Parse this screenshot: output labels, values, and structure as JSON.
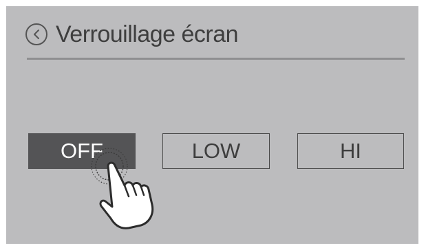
{
  "header": {
    "back_icon": "chevron-left-circle-icon",
    "title": "Verrouillage écran"
  },
  "options": [
    {
      "label": "OFF",
      "selected": true
    },
    {
      "label": "LOW",
      "selected": false
    },
    {
      "label": "HI",
      "selected": false
    }
  ],
  "touch_indicator": "tap-hand-icon",
  "colors": {
    "screen_background": "#bcbcbe",
    "selected_background": "#545456",
    "text": "#3e3e3e",
    "divider": "#8f8f91"
  }
}
